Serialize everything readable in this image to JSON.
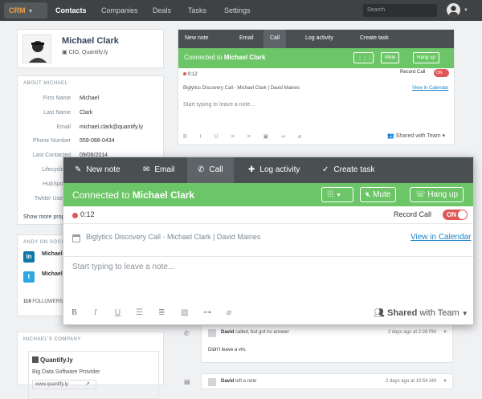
{
  "topnav": {
    "brand": "CRM",
    "items": [
      {
        "label": "Contacts",
        "active": true
      },
      {
        "label": "Companies"
      },
      {
        "label": "Deals"
      },
      {
        "label": "Tasks"
      },
      {
        "label": "Settings"
      }
    ],
    "search_placeholder": "Search"
  },
  "contact": {
    "name": "Michael Clark",
    "title": "CIO, Quantify.ly"
  },
  "about": {
    "header": "ABOUT MICHAEL",
    "fields": [
      {
        "label": "First Name",
        "value": "Michael"
      },
      {
        "label": "Last Name",
        "value": "Clark"
      },
      {
        "label": "Email",
        "value": "michael.clark@quantify.ly"
      },
      {
        "label": "Phone Number",
        "value": "559-088-0434"
      },
      {
        "label": "Last Contacted",
        "value": "09/06/2014"
      },
      {
        "label": "Lifecycle St",
        "value": ""
      },
      {
        "label": "HubSpot O",
        "value": ""
      },
      {
        "label": "Twitter Userna",
        "value": ""
      }
    ],
    "show_more": "Show more prope"
  },
  "social": {
    "header": "ANDY ON SOCIAL",
    "entries": [
      {
        "name": "Michael"
      },
      {
        "name": "Michael"
      }
    ],
    "followers_count": "119",
    "followers_label": "FOLLOWERS"
  },
  "company_card": {
    "header": "MICHAEL'S COMPANY",
    "name": "Quantify.ly",
    "description": "Big Data Software Provider",
    "url": "www.quantify.ly"
  },
  "composer": {
    "tabs": [
      {
        "label": "New note",
        "icon": "edit-icon"
      },
      {
        "label": "Email",
        "icon": "envelope-icon"
      },
      {
        "label": "Call",
        "icon": "phone-icon",
        "active": true
      },
      {
        "label": "Log activity",
        "icon": "plus-icon"
      },
      {
        "label": "Create task",
        "icon": "check-circle-icon"
      }
    ],
    "connected_prefix": "Connected to",
    "connected_name": "Michael Clark",
    "mute": "Mute",
    "hangup": "Hang up",
    "timer": "0:12",
    "record_call": "Record Call",
    "record_toggle": "ON",
    "meeting": "Biglytics Discovery Call - Michael Clark | David Maines",
    "view_calendar": "View in Calendar",
    "note_placeholder": "Start typing to leave a note...",
    "shared_bold": "Shared",
    "shared_rest": "with Team",
    "toolbar_icons": [
      "bold-icon",
      "italic-icon",
      "underline-icon",
      "bullet-list-icon",
      "numbered-list-icon",
      "image-icon",
      "link-icon",
      "attachment-icon"
    ]
  },
  "timeline": [
    {
      "author": "David",
      "action": "called, but got no answer",
      "time": "2 days ago at 2:28 PM",
      "body": "Didn't leave a vm."
    },
    {
      "author": "David",
      "action": "left a note",
      "time": "2 days ago at 10:54 AM",
      "body": ""
    }
  ],
  "colors": {
    "green": "#6cc667",
    "dark_bar": "#4a4f52",
    "rec_red": "#e05757",
    "link": "#1b82c8",
    "brand_orange": "#f4a04a"
  }
}
